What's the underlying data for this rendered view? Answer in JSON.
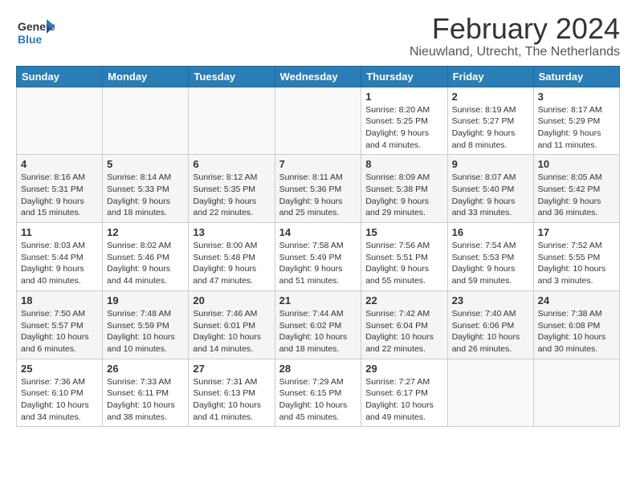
{
  "logo": {
    "general": "General",
    "blue": "Blue"
  },
  "title": "February 2024",
  "subtitle": "Nieuwland, Utrecht, The Netherlands",
  "days_of_week": [
    "Sunday",
    "Monday",
    "Tuesday",
    "Wednesday",
    "Thursday",
    "Friday",
    "Saturday"
  ],
  "weeks": [
    [
      {
        "day": "",
        "info": ""
      },
      {
        "day": "",
        "info": ""
      },
      {
        "day": "",
        "info": ""
      },
      {
        "day": "",
        "info": ""
      },
      {
        "day": "1",
        "info": "Sunrise: 8:20 AM\nSunset: 5:25 PM\nDaylight: 9 hours and 4 minutes."
      },
      {
        "day": "2",
        "info": "Sunrise: 8:19 AM\nSunset: 5:27 PM\nDaylight: 9 hours and 8 minutes."
      },
      {
        "day": "3",
        "info": "Sunrise: 8:17 AM\nSunset: 5:29 PM\nDaylight: 9 hours and 11 minutes."
      }
    ],
    [
      {
        "day": "4",
        "info": "Sunrise: 8:16 AM\nSunset: 5:31 PM\nDaylight: 9 hours and 15 minutes."
      },
      {
        "day": "5",
        "info": "Sunrise: 8:14 AM\nSunset: 5:33 PM\nDaylight: 9 hours and 18 minutes."
      },
      {
        "day": "6",
        "info": "Sunrise: 8:12 AM\nSunset: 5:35 PM\nDaylight: 9 hours and 22 minutes."
      },
      {
        "day": "7",
        "info": "Sunrise: 8:11 AM\nSunset: 5:36 PM\nDaylight: 9 hours and 25 minutes."
      },
      {
        "day": "8",
        "info": "Sunrise: 8:09 AM\nSunset: 5:38 PM\nDaylight: 9 hours and 29 minutes."
      },
      {
        "day": "9",
        "info": "Sunrise: 8:07 AM\nSunset: 5:40 PM\nDaylight: 9 hours and 33 minutes."
      },
      {
        "day": "10",
        "info": "Sunrise: 8:05 AM\nSunset: 5:42 PM\nDaylight: 9 hours and 36 minutes."
      }
    ],
    [
      {
        "day": "11",
        "info": "Sunrise: 8:03 AM\nSunset: 5:44 PM\nDaylight: 9 hours and 40 minutes."
      },
      {
        "day": "12",
        "info": "Sunrise: 8:02 AM\nSunset: 5:46 PM\nDaylight: 9 hours and 44 minutes."
      },
      {
        "day": "13",
        "info": "Sunrise: 8:00 AM\nSunset: 5:48 PM\nDaylight: 9 hours and 47 minutes."
      },
      {
        "day": "14",
        "info": "Sunrise: 7:58 AM\nSunset: 5:49 PM\nDaylight: 9 hours and 51 minutes."
      },
      {
        "day": "15",
        "info": "Sunrise: 7:56 AM\nSunset: 5:51 PM\nDaylight: 9 hours and 55 minutes."
      },
      {
        "day": "16",
        "info": "Sunrise: 7:54 AM\nSunset: 5:53 PM\nDaylight: 9 hours and 59 minutes."
      },
      {
        "day": "17",
        "info": "Sunrise: 7:52 AM\nSunset: 5:55 PM\nDaylight: 10 hours and 3 minutes."
      }
    ],
    [
      {
        "day": "18",
        "info": "Sunrise: 7:50 AM\nSunset: 5:57 PM\nDaylight: 10 hours and 6 minutes."
      },
      {
        "day": "19",
        "info": "Sunrise: 7:48 AM\nSunset: 5:59 PM\nDaylight: 10 hours and 10 minutes."
      },
      {
        "day": "20",
        "info": "Sunrise: 7:46 AM\nSunset: 6:01 PM\nDaylight: 10 hours and 14 minutes."
      },
      {
        "day": "21",
        "info": "Sunrise: 7:44 AM\nSunset: 6:02 PM\nDaylight: 10 hours and 18 minutes."
      },
      {
        "day": "22",
        "info": "Sunrise: 7:42 AM\nSunset: 6:04 PM\nDaylight: 10 hours and 22 minutes."
      },
      {
        "day": "23",
        "info": "Sunrise: 7:40 AM\nSunset: 6:06 PM\nDaylight: 10 hours and 26 minutes."
      },
      {
        "day": "24",
        "info": "Sunrise: 7:38 AM\nSunset: 6:08 PM\nDaylight: 10 hours and 30 minutes."
      }
    ],
    [
      {
        "day": "25",
        "info": "Sunrise: 7:36 AM\nSunset: 6:10 PM\nDaylight: 10 hours and 34 minutes."
      },
      {
        "day": "26",
        "info": "Sunrise: 7:33 AM\nSunset: 6:11 PM\nDaylight: 10 hours and 38 minutes."
      },
      {
        "day": "27",
        "info": "Sunrise: 7:31 AM\nSunset: 6:13 PM\nDaylight: 10 hours and 41 minutes."
      },
      {
        "day": "28",
        "info": "Sunrise: 7:29 AM\nSunset: 6:15 PM\nDaylight: 10 hours and 45 minutes."
      },
      {
        "day": "29",
        "info": "Sunrise: 7:27 AM\nSunset: 6:17 PM\nDaylight: 10 hours and 49 minutes."
      },
      {
        "day": "",
        "info": ""
      },
      {
        "day": "",
        "info": ""
      }
    ]
  ]
}
